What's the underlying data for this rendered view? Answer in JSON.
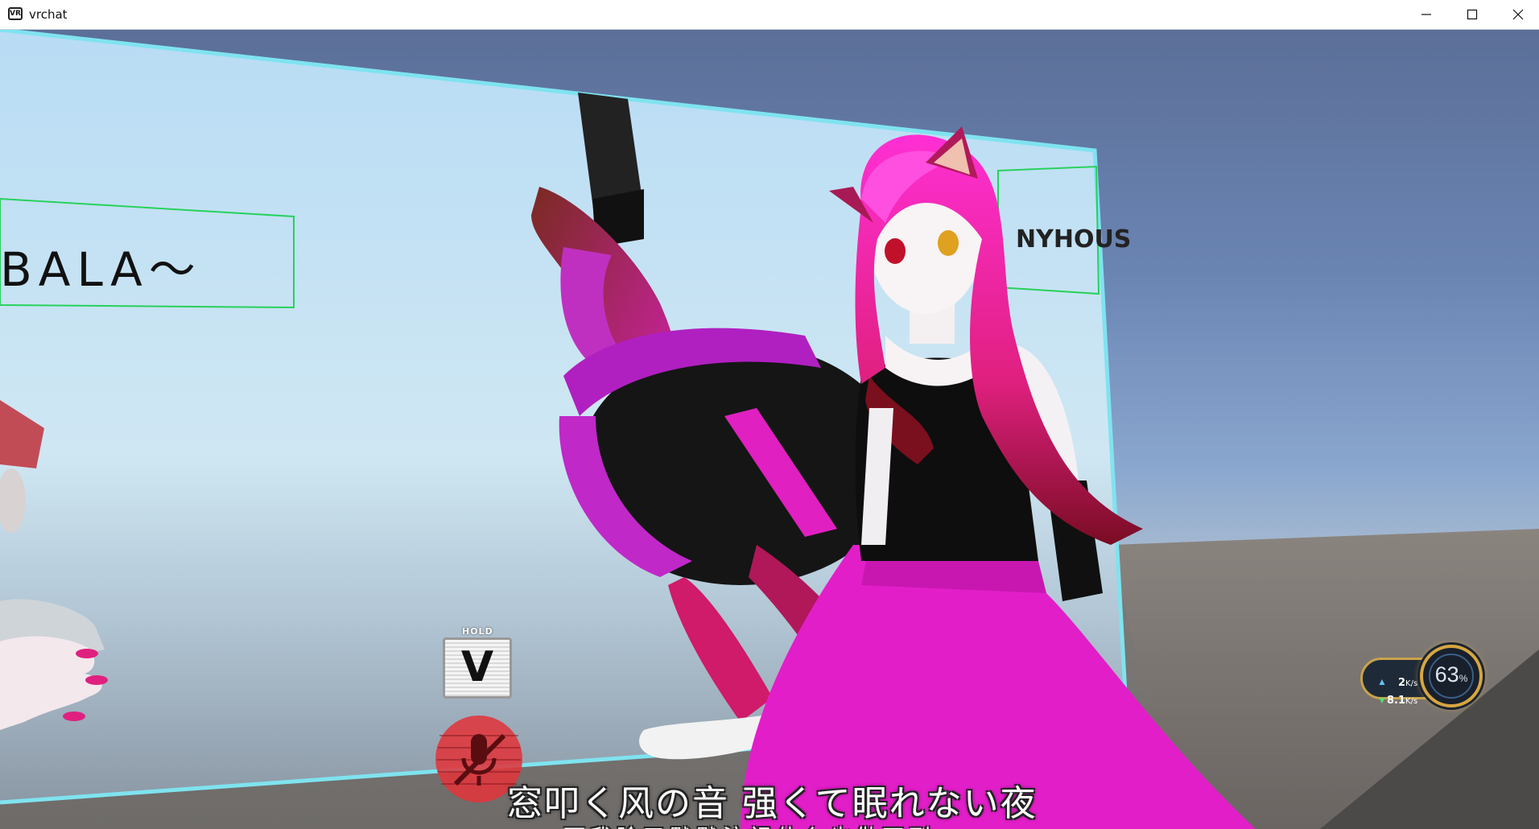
{
  "window": {
    "app_icon_text": "VR",
    "title": "vrchat",
    "controls": [
      "minimize",
      "maximize",
      "close"
    ]
  },
  "scene": {
    "sign_left_text": "BALA～",
    "sign_right_text": "NYHOUS"
  },
  "hud": {
    "hold_label": "HOLD",
    "hold_key": "V",
    "mic_status": "muted",
    "network": {
      "up_value": "2",
      "up_unit": "K/s",
      "down_value": "8.1",
      "down_unit": "K/s"
    },
    "performance": {
      "value": "63",
      "unit": "%"
    }
  },
  "subtitles": {
    "line1": "窓叩く风の音 强くて眠れない夜",
    "line2": "而我除了默默注视什么也做不到"
  },
  "colors": {
    "accent_gold": "#d6a640",
    "mic_red": "#e0353b",
    "panel_glow": "#7fe3f0"
  }
}
